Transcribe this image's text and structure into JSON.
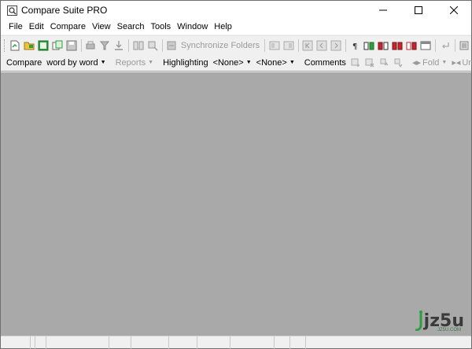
{
  "window": {
    "title": "Compare Suite PRO"
  },
  "menu": [
    "File",
    "Edit",
    "Compare",
    "View",
    "Search",
    "Tools",
    "Window",
    "Help"
  ],
  "toolbar1": {
    "sync_label": "Synchronize Folders"
  },
  "toolbar2": {
    "compare_label": "Compare",
    "mode_value": "word by word",
    "reports_label": "Reports",
    "highlighting_label": "Highlighting",
    "highlight_left": "<None>",
    "highlight_right": "<None>",
    "comments_label": "Comments",
    "fold_label": "Fold",
    "unfold_label": "Unfold"
  },
  "watermark": {
    "text": "jz5u",
    "sub": "JZ5U.COM"
  },
  "colors": {
    "workspace": "#a9a9a9",
    "accent_green": "#2e9e3e",
    "accent_red": "#c0282e"
  }
}
